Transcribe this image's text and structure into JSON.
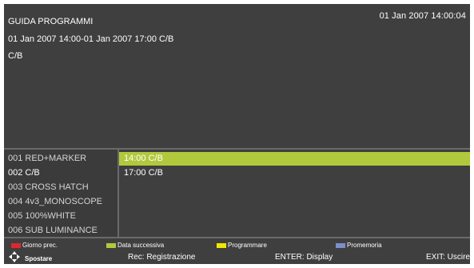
{
  "header": {
    "title": "GUIDA PROGRAMMI",
    "clock": "01 Jan 2007 14:00:04",
    "time_range": "01 Jan 2007 14:00-01 Jan 2007 17:00 C/B",
    "program_name": "C/B"
  },
  "channels": [
    {
      "label": "001  RED+MARKER"
    },
    {
      "label": "002  C/B"
    },
    {
      "label": "003  CROSS HATCH"
    },
    {
      "label": "004  4v3_MONOSCOPE"
    },
    {
      "label": "005  100%WHITE"
    },
    {
      "label": "006  SUB LUMINANCE"
    }
  ],
  "programs": [
    {
      "label": "14:00 C/B"
    },
    {
      "label": "17:00 C/B"
    }
  ],
  "legend": {
    "red": {
      "label": "Giorno prec.",
      "color": "#e2262d"
    },
    "green": {
      "label": "Data successiva",
      "color": "#b1c93c"
    },
    "yellow": {
      "label": "Programmare",
      "color": "#f2e500"
    },
    "blue": {
      "label": "Promemoria",
      "color": "#7b8fc8"
    }
  },
  "bottom": {
    "move_label": "Spostare",
    "move_icon": "four-way-arrow-icon",
    "rec": "Rec: Registrazione",
    "enter": "ENTER: Display",
    "exit": "EXIT: Uscire"
  },
  "colors": {
    "background": "#3f3f3f",
    "highlight": "#b1c93c",
    "separator": "#6a6a6a"
  }
}
